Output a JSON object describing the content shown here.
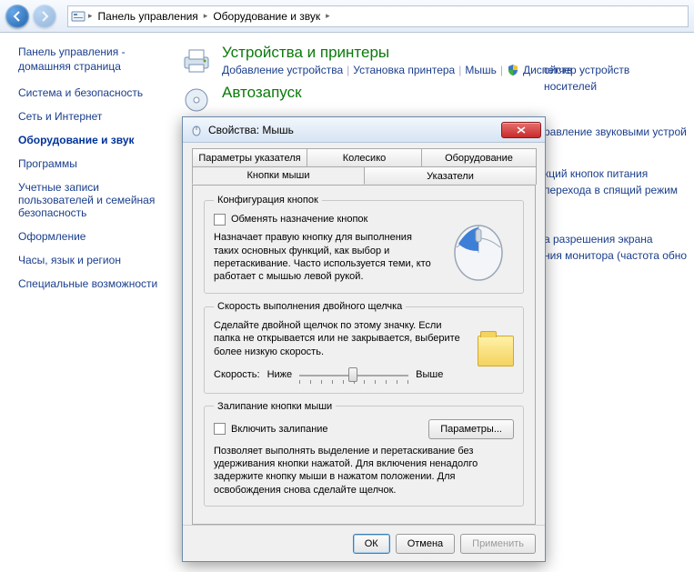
{
  "breadcrumb": {
    "p1": "Панель управления",
    "p2": "Оборудование и звук"
  },
  "sidebar": {
    "home": "Панель управления - домашняя страница",
    "items": [
      "Система и безопасность",
      "Сеть и Интернет",
      "Оборудование и звук",
      "Программы",
      "Учетные записи пользователей и семейная безопасность",
      "Оформление",
      "Часы, язык и регион",
      "Специальные возможности"
    ]
  },
  "sections": {
    "devices": {
      "title": "Устройства и принтеры",
      "l1": "Добавление устройства",
      "l2": "Установка принтера",
      "l3": "Мышь",
      "l4": "Диспетчер устройств"
    },
    "autorun": {
      "title": "Автозапуск",
      "p1": "ойств",
      "p2": "носителей"
    },
    "sound_partial": "равление звуковыми устрой",
    "power": {
      "p1": "кций кнопок питания",
      "p2": "перехода в спящий режим"
    },
    "display": {
      "p1": "а разрешения экрана",
      "p2": "ния монитора (частота обно"
    }
  },
  "dialog": {
    "title": "Свойства: Мышь",
    "tabs": {
      "r1": [
        "Параметры указателя",
        "Колесико",
        "Оборудование"
      ],
      "r2": [
        "Кнопки мыши",
        "Указатели"
      ]
    },
    "grp_config": {
      "legend": "Конфигурация кнопок",
      "chk": "Обменять назначение кнопок",
      "desc": "Назначает правую кнопку для выполнения таких основных функций, как выбор и перетаскивание. Часто используется теми, кто работает с мышью левой рукой."
    },
    "grp_speed": {
      "legend": "Скорость выполнения двойного щелчка",
      "desc": "Сделайте двойной щелчок по этому значку. Если папка не открывается или не закрывается, выберите более низкую скорость.",
      "label": "Скорость:",
      "low": "Ниже",
      "high": "Выше"
    },
    "grp_lock": {
      "legend": "Залипание кнопки мыши",
      "chk": "Включить залипание",
      "btn": "Параметры...",
      "desc": "Позволяет выполнять выделение и перетаскивание без удерживания кнопки нажатой. Для включения ненадолго задержите кнопку мыши в нажатом положении. Для освобождения снова сделайте щелчок."
    },
    "buttons": {
      "ok": "ОК",
      "cancel": "Отмена",
      "apply": "Применить"
    }
  }
}
